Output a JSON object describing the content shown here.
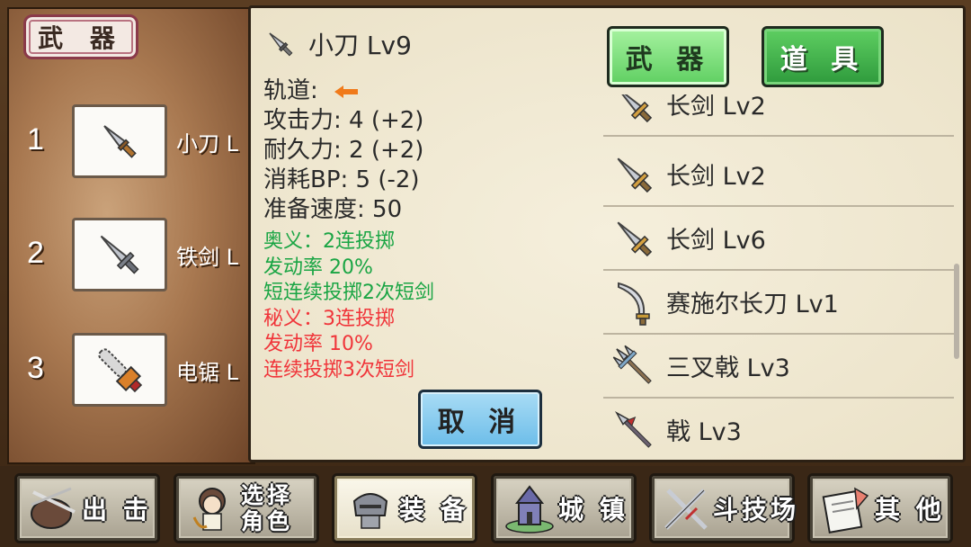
{
  "left_panel": {
    "tab_label": "武 器",
    "slots": [
      {
        "number": "1",
        "name": "小刀 L",
        "icon": "dagger-icon"
      },
      {
        "number": "2",
        "name": "铁剑 L",
        "icon": "iron-sword-icon"
      },
      {
        "number": "3",
        "name": "电锯 L",
        "icon": "chainsaw-icon"
      }
    ]
  },
  "detail": {
    "weapon_name": "小刀 Lv9",
    "weapon_icon": "dagger-icon",
    "stats": [
      "轨道:",
      "攻击力: 4 (+2)",
      "耐久力: 2 (+2)",
      "消耗BP: 5 (-2)",
      "准备速度: 50"
    ],
    "skill_green": [
      "奥义：2连投掷",
      "发动率 20%",
      "短连续投掷2次短剑"
    ],
    "skill_red": [
      "秘义：3连投掷",
      "发动率 10%",
      "连续投掷3次短剑"
    ],
    "cancel_label": "取 消"
  },
  "tabs": {
    "weapon_label": "武 器",
    "item_label": "道 具"
  },
  "list": {
    "items": [
      {
        "label": "长剑 Lv2",
        "icon": "long-sword-icon"
      },
      {
        "label": "长剑 Lv2",
        "icon": "long-sword-icon"
      },
      {
        "label": "长剑 Lv6",
        "icon": "long-sword-icon"
      },
      {
        "label": "赛施尔长刀 Lv1",
        "icon": "scimitar-icon"
      },
      {
        "label": "三叉戟 Lv3",
        "icon": "trident-icon"
      },
      {
        "label": "戟 Lv3",
        "icon": "halberd-icon"
      }
    ]
  },
  "bottom_nav": {
    "items": [
      {
        "label": "出 击",
        "icon": "sortie-icon"
      },
      {
        "label_line1": "选择",
        "label_line2": "角色",
        "icon": "character-icon"
      },
      {
        "label": "装 备",
        "icon": "equipment-icon"
      },
      {
        "label": "城 镇",
        "icon": "town-icon"
      },
      {
        "label": "斗技场",
        "icon": "arena-icon"
      },
      {
        "label": "其 他",
        "icon": "other-icon"
      }
    ]
  },
  "colors": {
    "skill_green": "#1aa544",
    "skill_red": "#f0353a",
    "trail_arrow": "#f07a1a"
  }
}
